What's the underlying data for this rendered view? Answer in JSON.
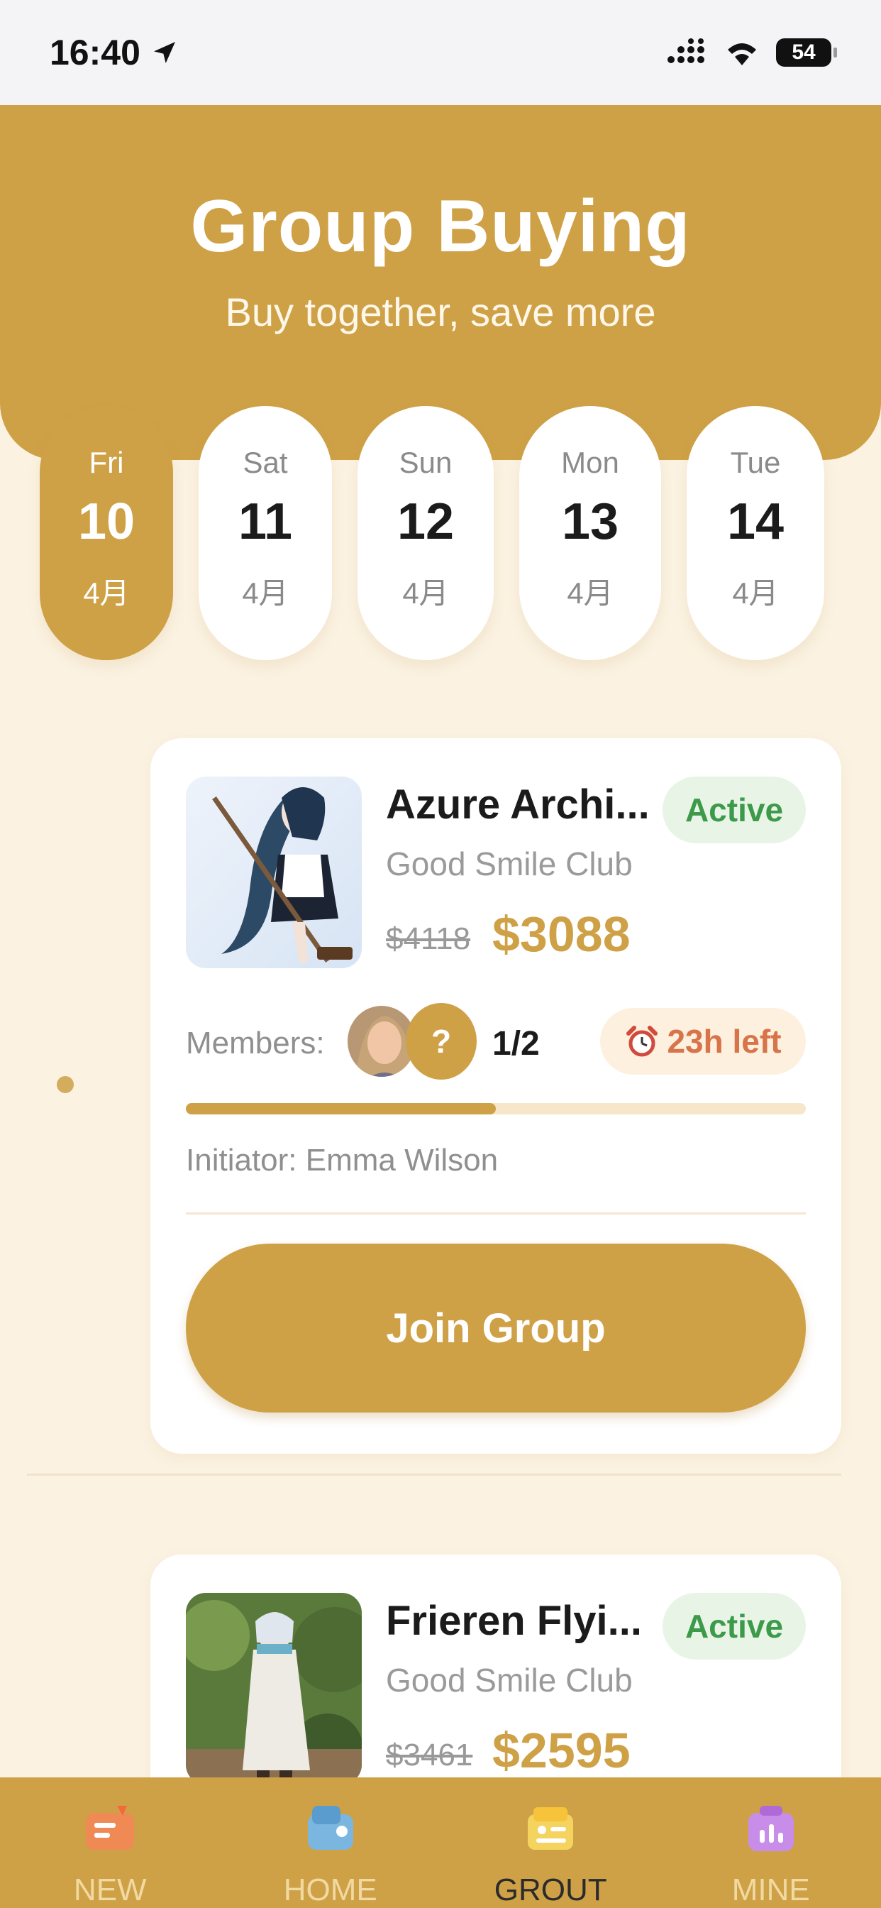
{
  "status_bar": {
    "time": "16:40",
    "battery": "54"
  },
  "header": {
    "title": "Group Buying",
    "subtitle": "Buy together, save more"
  },
  "dates": [
    {
      "dow": "Fri",
      "day": "10",
      "month": "4月",
      "active": true
    },
    {
      "dow": "Sat",
      "day": "11",
      "month": "4月",
      "active": false
    },
    {
      "dow": "Sun",
      "day": "12",
      "month": "4月",
      "active": false
    },
    {
      "dow": "Mon",
      "day": "13",
      "month": "4月",
      "active": false
    },
    {
      "dow": "Tue",
      "day": "14",
      "month": "4月",
      "active": false
    }
  ],
  "groups": [
    {
      "title": "Azure Archi...",
      "status": "Active",
      "brand": "Good Smile Club",
      "old_price": "$4118",
      "price": "$3088",
      "members_label": "Members:",
      "members_count": "1/2",
      "progress": 0.5,
      "time_left": "23h left",
      "initiator": "Initiator: Emma Wilson",
      "join_label": "Join Group"
    },
    {
      "title": "Frieren Flyi...",
      "status": "Active",
      "brand": "Good Smile Club",
      "old_price": "$3461",
      "price": "$2595"
    }
  ],
  "unknown_member_symbol": "?",
  "tabs": [
    {
      "label": "NEW",
      "icon": "new-icon"
    },
    {
      "label": "HOME",
      "icon": "home-icon"
    },
    {
      "label": "GROUT",
      "icon": "group-icon",
      "active": true
    },
    {
      "label": "MINE",
      "icon": "mine-icon"
    }
  ],
  "colors": {
    "primary": "#cfa147",
    "background": "#fbf2e2",
    "active_green": "#3d9a4b",
    "alert_orange": "#d7744a"
  }
}
